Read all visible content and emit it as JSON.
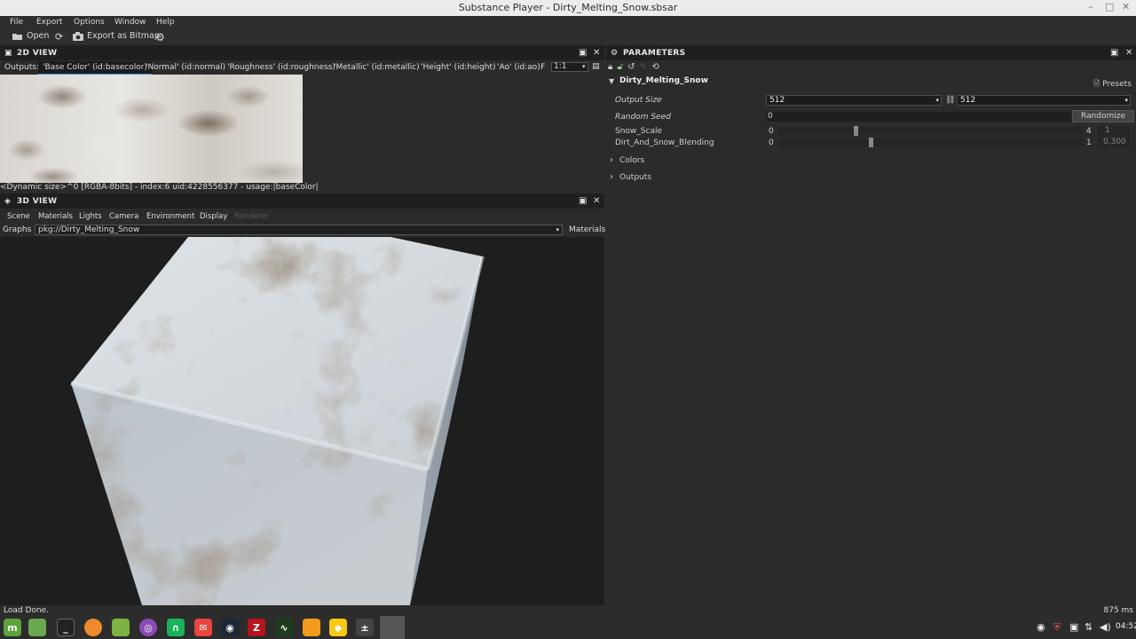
{
  "window": {
    "title": "Substance Player - Dirty_Melting_Snow.sbsar"
  },
  "menu": [
    "File",
    "Export",
    "Options",
    "Window",
    "Help"
  ],
  "toolbar": {
    "open": "Open",
    "export": "Export as Bitmap"
  },
  "view2d": {
    "title": "2D VIEW",
    "outputs_label": "Outputs:",
    "outputs": [
      "'Base Color' (id:basecolor)",
      "'Normal' (id:normal)",
      "'Roughness' (id:roughness)",
      "'Metallic' (id:metallic)",
      "'Height' (id:height)",
      "'Ao' (id:ao)",
      "F"
    ],
    "zoom": "1:1",
    "status": "<Dynamic size>^0 [RGBA-8bits] - index:6 uid:4228556377 - usage:|baseColor|"
  },
  "view3d": {
    "title": "3D VIEW",
    "tabs": [
      "Scene",
      "Materials",
      "Lights",
      "Camera",
      "Environment",
      "Display",
      "Renderer"
    ],
    "graphs_label": "Graphs :",
    "graph_value": "pkg://Dirty_Melting_Snow",
    "materials_label": "Materials"
  },
  "parameters": {
    "title": "PARAMETERS",
    "graph_name": "Dirty_Melting_Snow",
    "presets": "Presets",
    "output_size": {
      "label": "Output Size",
      "width": "512",
      "height": "512"
    },
    "random_seed": {
      "label": "Random Seed",
      "value": "0",
      "button": "Randomize"
    },
    "snow_scale": {
      "label": "Snow_Scale",
      "min": "0",
      "max": "4",
      "value": "1",
      "fraction": 0.25
    },
    "blending": {
      "label": "Dirt_And_Snow_Blending",
      "min": "0",
      "max": "1",
      "value": "0,300",
      "fraction": 0.3
    },
    "groups": [
      "Colors",
      "Outputs"
    ]
  },
  "status": {
    "message": "Load Done.",
    "timing": "875 ms"
  },
  "taskbar": {
    "clock": "04:52"
  }
}
